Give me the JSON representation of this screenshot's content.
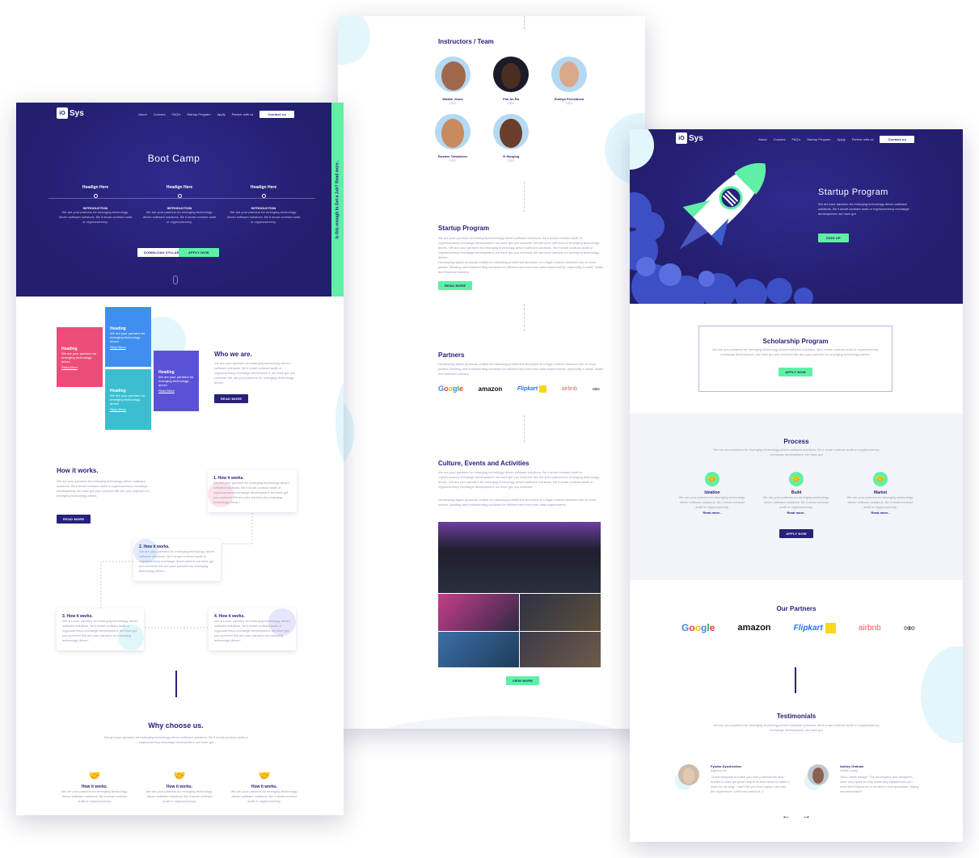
{
  "brand": {
    "logo_box": "iO",
    "logo_text": "Sys"
  },
  "nav": {
    "about": "About",
    "courses": "Courses",
    "faqs": "FAQ's",
    "startup": "Startup Program",
    "apply": "Apply",
    "partner": "Partner with us",
    "contact": "Contact us"
  },
  "left": {
    "hero_title": "Boot Camp",
    "side_banner": "Is this enough to Get a Job? Read more..",
    "steps": [
      {
        "heading": "Headign Here",
        "label": "INTRODUCTION",
        "text": "We are your partners for emerging technology-driven software solutions. Be it smart contract audit or cryptocurrency."
      },
      {
        "heading": "Headign Here",
        "label": "INTRODUCTION",
        "text": "We are your partners for emerging technology-driven software solutions. Be it smart contract audit or cryptocurrency."
      },
      {
        "heading": "Headign Here",
        "label": "INTRODUCTION",
        "text": "We are your partners for emerging technology-driven software solutions. Be it smart contract audit or cryptocurrency."
      }
    ],
    "download_btn": "DOWNLOAD SYLLABUS",
    "apply_btn": "APPLY NOW",
    "tiles": [
      {
        "heading": "Heading",
        "text": "We are your partners for emerging technology-driven",
        "link": "Read More",
        "color": "#ec4d78"
      },
      {
        "heading": "Heading",
        "text": "We are your partners for emerging technology-driven",
        "link": "Read More",
        "color": "#3f8ff0"
      },
      {
        "heading": "Heading",
        "text": "We are your partners for emerging technology-driven",
        "link": "Read More",
        "color": "#3bbfd0"
      },
      {
        "heading": "Heading",
        "text": "We are your partners for emerging technology-driven",
        "link": "Read More",
        "color": "#5a52d6"
      }
    ],
    "who_title": "Who we are.",
    "who_text": "We are your partners for emerging technology-driven software solutions. Be it smart contract audit or cryptocurrency exchange development, we have got you covered! We are your partners for emerging technology-driven.",
    "who_btn": "READ MORE",
    "how_title": "How it works.",
    "how_text": "We are your partners for emerging technology-driven software solutions. Be it smart contract audit or cryptocurrency exchange development, we have got you covered! We are your partners for emerging technology-driven.",
    "how_btn": "READ MORE",
    "how_cards": [
      {
        "title": "1. How it works.",
        "text": "We are your partners for emerging technology-driven software solutions. Be it smart contract audit or cryptocurrency exchange development, we have got you covered! We are your partners for emerging technology-driven."
      },
      {
        "title": "2. How it works.",
        "text": "We are your partners for emerging technology-driven software solutions. Be it smart contract audit or cryptocurrency exchange development, we have got you covered! We are your partners for emerging technology-driven."
      },
      {
        "title": "3. How it works.",
        "text": "We are your partners for emerging technology-driven software solutions. Be it smart contract audit or cryptocurrency exchange development, we have got you covered! We are your partners for emerging technology-driven."
      },
      {
        "title": "4. How it works.",
        "text": "We are your partners for emerging technology-driven software solutions. Be it smart contract audit or cryptocurrency exchange development, we have got you covered! We are your partners for emerging technology-driven."
      }
    ],
    "why_title": "Why choose us.",
    "why_text": "We are your partners for emerging technology-driven software solutions. Be it smart contract audit or cryptocurrency exchange development, we have got",
    "why_items": [
      {
        "title": "How it works.",
        "text": "We are your partners for emerging technology-driven software solutions. Be it smart contract audit or cryptocurrency."
      },
      {
        "title": "How it works.",
        "text": "We are your partners for emerging technology-driven software solutions. Be it smart contract audit or cryptocurrency."
      },
      {
        "title": "How it works.",
        "text": "We are your partners for emerging technology-driven software solutions. Be it smart contract audit or cryptocurrency."
      }
    ]
  },
  "middle": {
    "team_title": "Instructors / Team",
    "team": [
      {
        "name": "Miriam Jesus",
        "role": "CEO"
      },
      {
        "name": "Pok Ae-Ra",
        "role": "CEO"
      },
      {
        "name": "Emiliya Perevalova",
        "role": "CEO"
      },
      {
        "name": "Rustem Tolstobrov",
        "role": "CEO"
      },
      {
        "name": "Yi Hanqing",
        "role": "CEO"
      }
    ],
    "startup_title": "Startup Program",
    "startup_text1": "We are your partners for emerging technology-driven software solutions. Be it smart contract audit or cryptocurrency exchange development, we have got you covered! We are your partners for emerging technology-driven. We are your partners for emerging technology-driven software solutions. Be it smart contract audit or cryptocurrency exchange development, we have got you covered! We are your partners for emerging technology-driven.",
    "startup_text2": "Developing digital protocols crafted for validating predefined directives of a legal contract between two or more parties. Building and implementing solutions for efficient and error-free data requirements, especially in retail, health and financial industry.",
    "startup_btn": "READ MORE",
    "partners_title": "Partners",
    "partners_text": "Developing digital protocols crafted for validating predefined directives of a legal contract between two or more parties. Building and implementing solutions for efficient and error-free data requirements, especially in retail, health and financial industry.",
    "culture_title": "Culture, Events and Activities",
    "culture_text1": "We are your partners for emerging technology-driven software solutions. Be it smart contract audit or cryptocurrency exchange development, we have got you covered! We are your partners for emerging technology-driven. We are your partners for emerging technology-driven software solutions. Be it smart contract audit or cryptocurrency exchange development, we have got you covered!",
    "culture_text2": "Developing digital protocols crafted for validating predefined directives of a legal contract between two or more parties. Building and implementing solutions for efficient and error-free data requirements.",
    "view_btn": "VIEW MORE"
  },
  "partner_logos": {
    "google": [
      "G",
      "o",
      "o",
      "g",
      "l",
      "e"
    ],
    "amazon": "amazon",
    "flipkart": "Flipkart",
    "airbnb": "airbnb",
    "audi": "∞∞"
  },
  "right": {
    "hero_title": "Startup Program",
    "hero_text": "We are your partners for emerging technology-driven software solutions. Be it smart contract audit or cryptocurrency exchange development, we have got",
    "signup_btn": "SIGN UP",
    "scholar_title": "Scholarship Program",
    "scholar_text": "We are your partners for emerging technology-driven software solutions. Be it smart contract audit or cryptocurrency exchange development, we have got you covered! We are your partners for emerging technology-driven.",
    "scholar_btn": "APPLY NOW",
    "process_title": "Process",
    "process_text": "We are your partners for emerging technology-driven software solutions. Be it smart contract audit or cryptocurrency exchange development, we have got",
    "process": [
      {
        "title": "Ideation",
        "text": "We are your partners for emerging technology-driven software solutions. Be it smart contract audit or cryptocurrency.",
        "link": "Read more.."
      },
      {
        "title": "Build",
        "text": "We are your partners for emerging technology-driven software solutions. Be it smart contract audit or cryptocurrency.",
        "link": "Read more.."
      },
      {
        "title": "Market",
        "text": "We are your partners for emerging technology-driven software solutions. Be it smart contract audit or cryptocurrency.",
        "link": "Read more.."
      }
    ],
    "process_btn": "APPLY NOW",
    "partners_title": "Our Partners",
    "testi_title": "Testimonials",
    "testi_text": "We are your partners for emerging technology-driven software solutions. Be it smart contract audit or cryptocurrency exchange development, we have got",
    "testimonials": [
      {
        "name": "Fyodor Dyuzhenkov",
        "role": "Agency Inc",
        "text": "\"Great template to make you look professional and modern! I also got great help from their team to make it work for my blog. I can't tell you how happy I am with the experience. 100% recommend :)\""
      },
      {
        "name": "Ashley Graham",
        "role": "Health Jump",
        "text": "\"Nice, sleek design. The developers and designers were very quick to help make any adjustments you need and helped me a lot when I had questions. Highly recommended!\""
      }
    ],
    "prev": "←",
    "next": "→"
  },
  "colors": {
    "navy": "#26217a",
    "mint": "#5ff0a6",
    "pink": "#ec4d78",
    "blue": "#3f8ff0",
    "teal": "#3bbfd0",
    "purple": "#5a52d6"
  }
}
